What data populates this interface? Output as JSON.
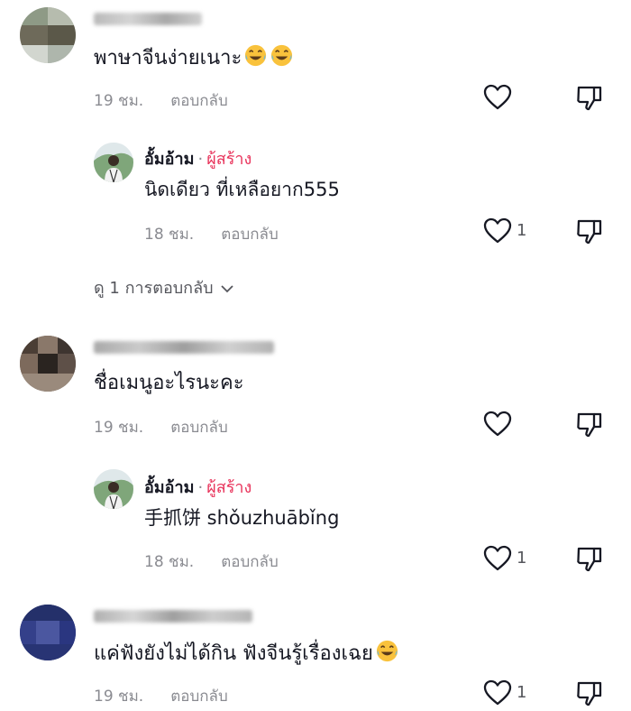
{
  "comments": [
    {
      "text": "พาษาจีนง่ายเนาะ",
      "emoji": "tears-of-joy-emoji",
      "time": "19 ชม.",
      "reply_label": "ตอบกลับ",
      "reply": {
        "author": "อั้มอ้าม",
        "dot": "·",
        "badge": "ผู้สร้าง",
        "text": "นิดเดียว ที่เหลือยาก555",
        "time": "18 ชม.",
        "reply_label": "ตอบกลับ",
        "likes": "1"
      },
      "view_replies": "ดู 1 การตอบกลับ"
    },
    {
      "text": "ชื่อเมนูอะไรนะคะ",
      "time": "19 ชม.",
      "reply_label": "ตอบกลับ",
      "reply": {
        "author": "อั้มอ้าม",
        "dot": "·",
        "badge": "ผู้สร้าง",
        "text": "手抓饼 shǒuzhuābǐng",
        "time": "18 ชม.",
        "reply_label": "ตอบกลับ",
        "likes": "1"
      }
    },
    {
      "text": "แค่ฟังยังไม่ได้กิน ฟังจีนรู้เรื่องเฉย",
      "emoji": "tears-of-joy-emoji",
      "time": "19 ชม.",
      "reply_label": "ตอบกลับ",
      "likes": "1"
    }
  ],
  "icons": {
    "like": "heart-outline-icon",
    "dislike": "thumbs-down-outline-icon",
    "chevron": "chevron-down-icon"
  },
  "colors": {
    "creator_badge": "#e8325a",
    "meta_gray": "#8a8b91",
    "text": "#161823"
  }
}
